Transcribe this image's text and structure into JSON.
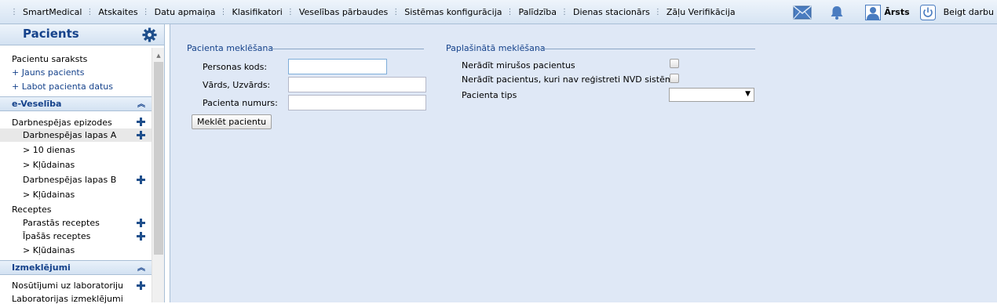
{
  "topbar": {
    "menu": [
      {
        "label": "SmartMedical"
      },
      {
        "label": "Atskaites"
      },
      {
        "label": "Datu apmaiņa"
      },
      {
        "label": "Klasifikatori"
      },
      {
        "label": "Veselības pārbaudes"
      },
      {
        "label": "Sistēmas konfigurācija"
      },
      {
        "label": "Palīdzība"
      },
      {
        "label": "Dienas stacionārs"
      },
      {
        "label": "Zāļu Verifikācija"
      }
    ],
    "user_name": "Ārsts",
    "logout_label": "Beigt darbu",
    "icons": [
      "mail-icon",
      "bell-icon",
      "user-icon",
      "power-icon"
    ]
  },
  "sidebar": {
    "title": "Pacients",
    "items": {
      "patient_list": "Pacientu saraksts",
      "new_patient": "+ Jauns pacients",
      "edit_patient": "+ Labot pacienta datus"
    },
    "eveseliba": {
      "header": "e-Veselība",
      "episodes": "Darbnespējas epizodes",
      "sheets_a": "Darbnespējas lapas A",
      "ten_days": "> 10 dienas",
      "errors_a": "> Kļūdainas",
      "sheets_b": "Darbnespējas lapas B",
      "errors_b": "> Kļūdainas",
      "recipes": "Receptes",
      "regular_recipes": "Parastās receptes",
      "special_recipes": "Īpašās receptes",
      "errors_recipes": "> Kļūdainas"
    },
    "izmeklejumi": {
      "header": "Izmeklējumi",
      "lab_referrals": "Nosūtījumi uz laboratoriju",
      "lab_results": "Laboratorijas izmeklējumi"
    }
  },
  "search": {
    "legend": "Pacienta meklēšana",
    "personal_code_label": "Personas kods:",
    "personal_code_value": "",
    "name_label": "Vārds, Uzvārds:",
    "name_value": "",
    "patient_number_label": "Pacienta numurs:",
    "patient_number_value": "",
    "search_button": "Meklēt pacientu"
  },
  "extended": {
    "legend": "Paplašinātā meklēšana",
    "no_deceased_label": "Nerādīt mirušos pacientus",
    "no_deceased_checked": false,
    "no_unregistered_label": "Nerādīt pacientus, kuri nav reģistreti NVD sistēmā",
    "no_unregistered_checked": false,
    "patient_type_label": "Pacienta tips",
    "patient_type_value": ""
  },
  "colors": {
    "accent": "#15428b",
    "main_bg": "#dfe8f6",
    "header_bg": "#d6e4f3"
  }
}
